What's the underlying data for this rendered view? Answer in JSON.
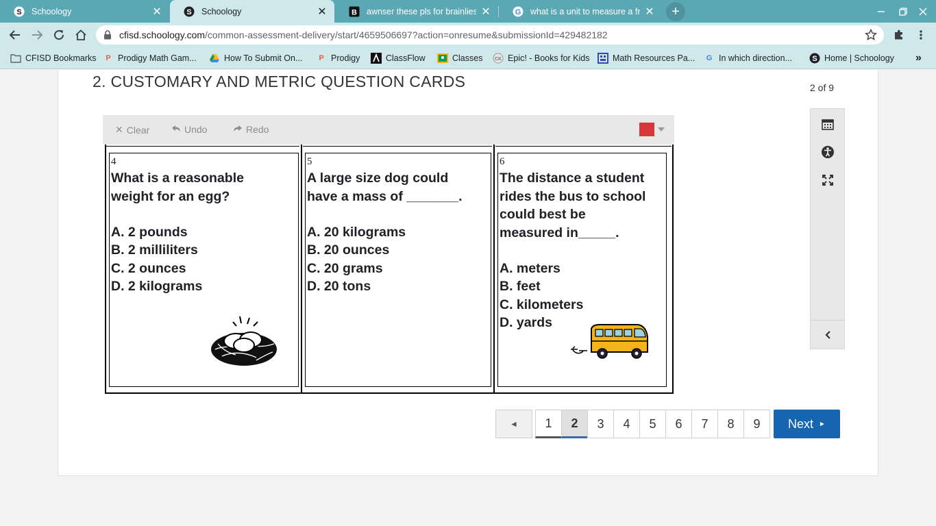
{
  "browser": {
    "tabs": [
      {
        "title": "Schoology",
        "active": false
      },
      {
        "title": "Schoology",
        "active": true
      },
      {
        "title": "awnser these pls for brainliest th",
        "active": false
      },
      {
        "title": "what is a unit to measure a frog",
        "active": false
      }
    ],
    "url_host": "cfisd.schoology.com",
    "url_path": "/common-assessment-delivery/start/4659506697?action=onresume&submissionId=429482182",
    "bookmarks": [
      {
        "label": "CFISD Bookmarks",
        "icon": "folder-icon"
      },
      {
        "label": "Prodigy Math Gam...",
        "icon": "prodigy-icon"
      },
      {
        "label": "How To Submit On...",
        "icon": "google-drive-icon"
      },
      {
        "label": "Prodigy",
        "icon": "prodigy-icon"
      },
      {
        "label": "ClassFlow",
        "icon": "classflow-icon"
      },
      {
        "label": "Classes",
        "icon": "google-classroom-icon"
      },
      {
        "label": "Epic! - Books for Kids",
        "icon": "epic-icon"
      },
      {
        "label": "Math Resources Pa...",
        "icon": "grid-icon"
      },
      {
        "label": "In which direction...",
        "icon": "google-icon"
      },
      {
        "label": "Home | Schoology",
        "icon": "schoology-icon"
      }
    ],
    "more_bookmarks": "»",
    "colors": {
      "chrome": "#cfe8ec",
      "tabbar": "#5ba8b5"
    }
  },
  "assessment": {
    "title": "2. CUSTOMARY AND METRIC QUESTION CARDS",
    "count": "2 of 9",
    "drawing_tools": {
      "clear": "Clear",
      "undo": "Undo",
      "redo": "Redo",
      "pen_color": "#d9363a"
    },
    "cards": [
      {
        "number": "4",
        "question_lines": [
          "What is a reasonable",
          "weight for an egg?"
        ],
        "options": [
          "A. 2 pounds",
          "B. 2 milliliters",
          "C. 2 ounces",
          "D. 2 kilograms"
        ],
        "illustration": "egg-nest-icon"
      },
      {
        "number": "5",
        "question_lines": [
          "A large size dog could",
          "have a mass of _______."
        ],
        "options": [
          "A. 20 kilograms",
          "B. 20 ounces",
          "C. 20 grams",
          "D. 20 tons"
        ]
      },
      {
        "number": "6",
        "question_lines": [
          "The distance a student",
          "rides the bus to school",
          "could best be",
          "measured in_____."
        ],
        "options": [
          "A. meters",
          "B. feet",
          "C. kilometers",
          "D. yards"
        ],
        "illustration": "school-bus-icon"
      }
    ],
    "pager": {
      "prev_symbol": "◄",
      "pages": [
        "1",
        "2",
        "3",
        "4",
        "5",
        "6",
        "7",
        "8",
        "9"
      ],
      "current": "2",
      "next_label": "Next",
      "next_symbol": "►",
      "accent": "#1565b0"
    }
  }
}
